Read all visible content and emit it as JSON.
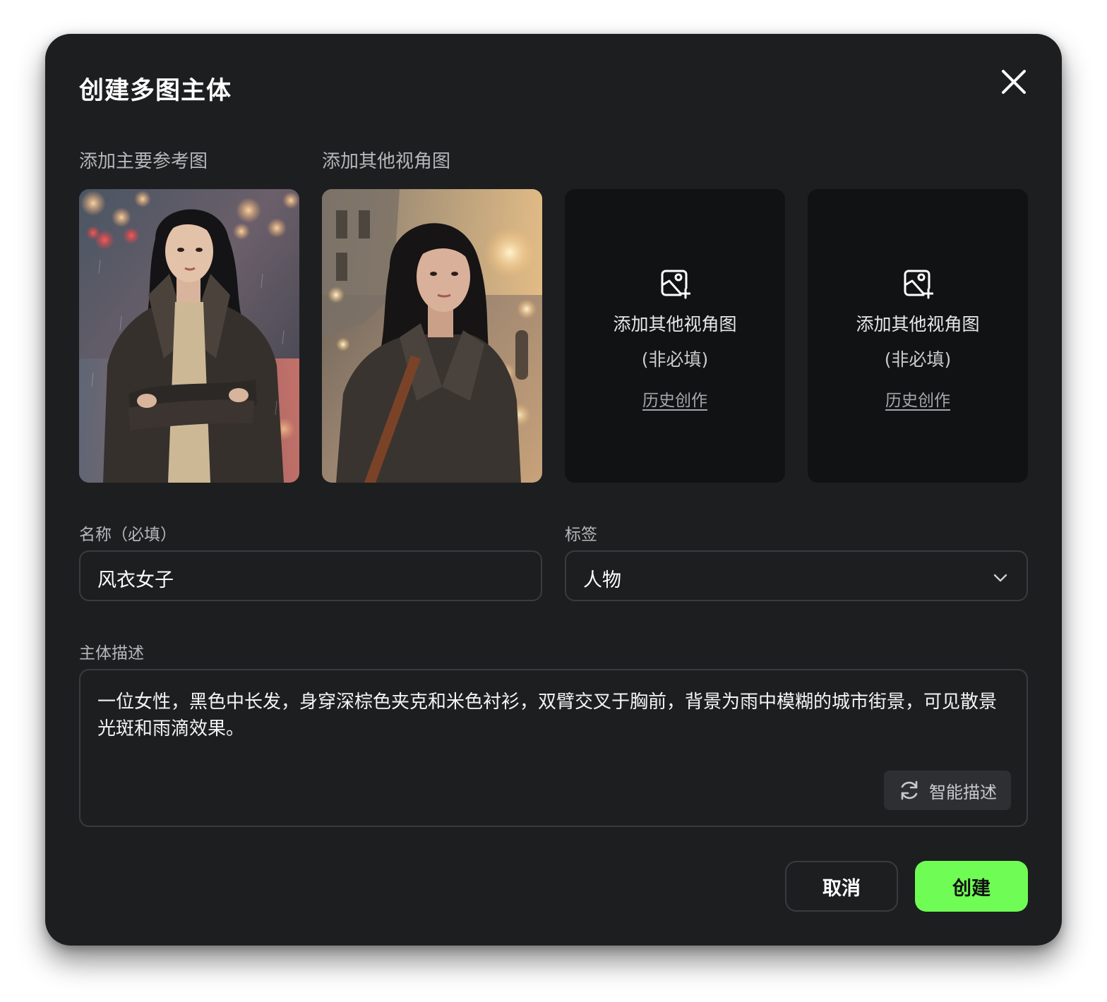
{
  "dialog": {
    "title": "创建多图主体"
  },
  "images": {
    "main_label": "添加主要参考图",
    "other_label": "添加其他视角图",
    "slots": [
      {
        "title": "添加其他视角图",
        "subtitle": "(非必填)",
        "history": "历史创作"
      },
      {
        "title": "添加其他视角图",
        "subtitle": "(非必填)",
        "history": "历史创作"
      }
    ]
  },
  "form": {
    "name_label": "名称（必填）",
    "name_value": "风衣女子",
    "tag_label": "标签",
    "tag_value": "人物",
    "desc_label": "主体描述",
    "desc_value": "一位女性，黑色中长发，身穿深棕色夹克和米色衬衫，双臂交叉于胸前，背景为雨中模糊的城市街景，可见散景光斑和雨滴效果。",
    "smart_desc_label": "智能描述"
  },
  "actions": {
    "cancel": "取消",
    "create": "创建"
  },
  "colors": {
    "accent": "#6ffc55",
    "surface": "#1d1e20",
    "tile": "#111214"
  },
  "icons": [
    "close-icon",
    "add-image-icon",
    "chevron-down-icon",
    "refresh-icon"
  ]
}
